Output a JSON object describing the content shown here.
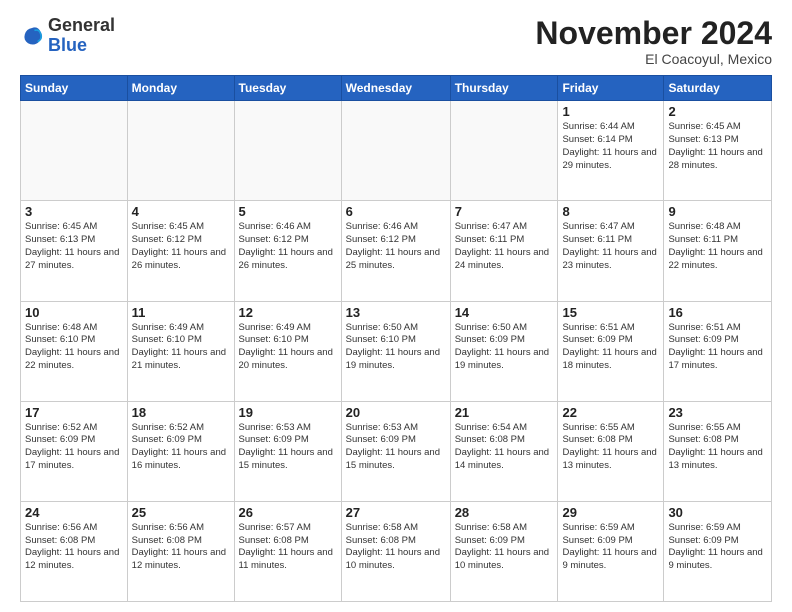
{
  "header": {
    "logo_general": "General",
    "logo_blue": "Blue",
    "month_title": "November 2024",
    "location": "El Coacoyul, Mexico"
  },
  "days_of_week": [
    "Sunday",
    "Monday",
    "Tuesday",
    "Wednesday",
    "Thursday",
    "Friday",
    "Saturday"
  ],
  "weeks": [
    [
      {
        "day": "",
        "info": ""
      },
      {
        "day": "",
        "info": ""
      },
      {
        "day": "",
        "info": ""
      },
      {
        "day": "",
        "info": ""
      },
      {
        "day": "",
        "info": ""
      },
      {
        "day": "1",
        "info": "Sunrise: 6:44 AM\nSunset: 6:14 PM\nDaylight: 11 hours and 29 minutes."
      },
      {
        "day": "2",
        "info": "Sunrise: 6:45 AM\nSunset: 6:13 PM\nDaylight: 11 hours and 28 minutes."
      }
    ],
    [
      {
        "day": "3",
        "info": "Sunrise: 6:45 AM\nSunset: 6:13 PM\nDaylight: 11 hours and 27 minutes."
      },
      {
        "day": "4",
        "info": "Sunrise: 6:45 AM\nSunset: 6:12 PM\nDaylight: 11 hours and 26 minutes."
      },
      {
        "day": "5",
        "info": "Sunrise: 6:46 AM\nSunset: 6:12 PM\nDaylight: 11 hours and 26 minutes."
      },
      {
        "day": "6",
        "info": "Sunrise: 6:46 AM\nSunset: 6:12 PM\nDaylight: 11 hours and 25 minutes."
      },
      {
        "day": "7",
        "info": "Sunrise: 6:47 AM\nSunset: 6:11 PM\nDaylight: 11 hours and 24 minutes."
      },
      {
        "day": "8",
        "info": "Sunrise: 6:47 AM\nSunset: 6:11 PM\nDaylight: 11 hours and 23 minutes."
      },
      {
        "day": "9",
        "info": "Sunrise: 6:48 AM\nSunset: 6:11 PM\nDaylight: 11 hours and 22 minutes."
      }
    ],
    [
      {
        "day": "10",
        "info": "Sunrise: 6:48 AM\nSunset: 6:10 PM\nDaylight: 11 hours and 22 minutes."
      },
      {
        "day": "11",
        "info": "Sunrise: 6:49 AM\nSunset: 6:10 PM\nDaylight: 11 hours and 21 minutes."
      },
      {
        "day": "12",
        "info": "Sunrise: 6:49 AM\nSunset: 6:10 PM\nDaylight: 11 hours and 20 minutes."
      },
      {
        "day": "13",
        "info": "Sunrise: 6:50 AM\nSunset: 6:10 PM\nDaylight: 11 hours and 19 minutes."
      },
      {
        "day": "14",
        "info": "Sunrise: 6:50 AM\nSunset: 6:09 PM\nDaylight: 11 hours and 19 minutes."
      },
      {
        "day": "15",
        "info": "Sunrise: 6:51 AM\nSunset: 6:09 PM\nDaylight: 11 hours and 18 minutes."
      },
      {
        "day": "16",
        "info": "Sunrise: 6:51 AM\nSunset: 6:09 PM\nDaylight: 11 hours and 17 minutes."
      }
    ],
    [
      {
        "day": "17",
        "info": "Sunrise: 6:52 AM\nSunset: 6:09 PM\nDaylight: 11 hours and 17 minutes."
      },
      {
        "day": "18",
        "info": "Sunrise: 6:52 AM\nSunset: 6:09 PM\nDaylight: 11 hours and 16 minutes."
      },
      {
        "day": "19",
        "info": "Sunrise: 6:53 AM\nSunset: 6:09 PM\nDaylight: 11 hours and 15 minutes."
      },
      {
        "day": "20",
        "info": "Sunrise: 6:53 AM\nSunset: 6:09 PM\nDaylight: 11 hours and 15 minutes."
      },
      {
        "day": "21",
        "info": "Sunrise: 6:54 AM\nSunset: 6:08 PM\nDaylight: 11 hours and 14 minutes."
      },
      {
        "day": "22",
        "info": "Sunrise: 6:55 AM\nSunset: 6:08 PM\nDaylight: 11 hours and 13 minutes."
      },
      {
        "day": "23",
        "info": "Sunrise: 6:55 AM\nSunset: 6:08 PM\nDaylight: 11 hours and 13 minutes."
      }
    ],
    [
      {
        "day": "24",
        "info": "Sunrise: 6:56 AM\nSunset: 6:08 PM\nDaylight: 11 hours and 12 minutes."
      },
      {
        "day": "25",
        "info": "Sunrise: 6:56 AM\nSunset: 6:08 PM\nDaylight: 11 hours and 12 minutes."
      },
      {
        "day": "26",
        "info": "Sunrise: 6:57 AM\nSunset: 6:08 PM\nDaylight: 11 hours and 11 minutes."
      },
      {
        "day": "27",
        "info": "Sunrise: 6:58 AM\nSunset: 6:08 PM\nDaylight: 11 hours and 10 minutes."
      },
      {
        "day": "28",
        "info": "Sunrise: 6:58 AM\nSunset: 6:09 PM\nDaylight: 11 hours and 10 minutes."
      },
      {
        "day": "29",
        "info": "Sunrise: 6:59 AM\nSunset: 6:09 PM\nDaylight: 11 hours and 9 minutes."
      },
      {
        "day": "30",
        "info": "Sunrise: 6:59 AM\nSunset: 6:09 PM\nDaylight: 11 hours and 9 minutes."
      }
    ]
  ]
}
